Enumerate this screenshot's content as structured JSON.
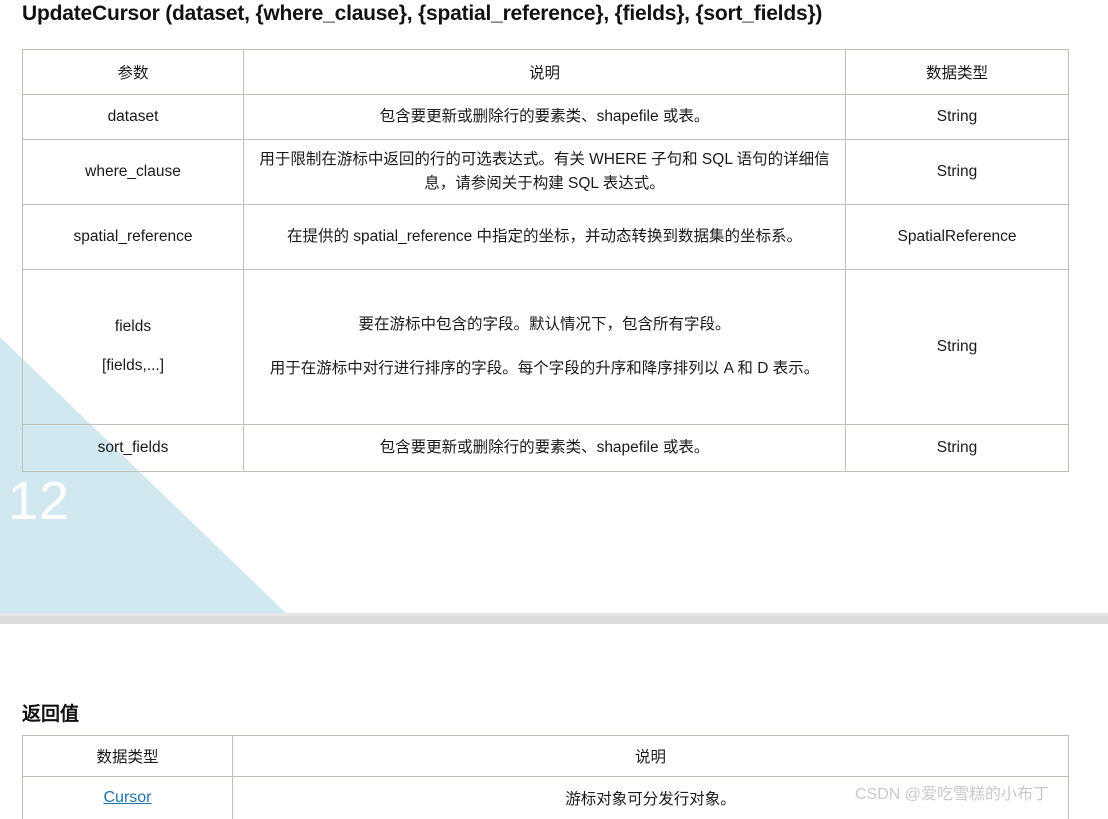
{
  "slide1": {
    "title": "UpdateCursor (dataset, {where_clause}, {spatial_reference}, {fields}, {sort_fields})",
    "page_number": "12",
    "decoration_color": "#d2e8f0",
    "param_table": {
      "headers": [
        "参数",
        "说明",
        "数据类型"
      ],
      "rows": [
        {
          "param": "dataset",
          "param_sub": "",
          "desc": [
            "包含要更新或删除行的要素类、shapefile 或表。"
          ],
          "type": "String"
        },
        {
          "param": "where_clause",
          "param_sub": "",
          "desc": [
            "用于限制在游标中返回的行的可选表达式。有关 WHERE 子句和 SQL 语句的详细信息，请参阅关于构建 SQL 表达式。"
          ],
          "type": "String"
        },
        {
          "param": "spatial_reference",
          "param_sub": "",
          "desc": [
            "在提供的 spatial_reference 中指定的坐标，并动态转换到数据集的坐标系。"
          ],
          "type": "SpatialReference"
        },
        {
          "param": "fields",
          "param_sub": "[fields,...]",
          "desc": [
            "要在游标中包含的字段。默认情况下，包含所有字段。",
            "用于在游标中对行进行排序的字段。每个字段的升序和降序排列以 A 和 D 表示。"
          ],
          "type": "String"
        },
        {
          "param": "sort_fields",
          "param_sub": "",
          "desc": [
            "包含要更新或删除行的要素类、shapefile 或表。"
          ],
          "type": "String"
        }
      ]
    }
  },
  "slide2": {
    "heading": "返回值",
    "return_table": {
      "headers": [
        "数据类型",
        "说明"
      ],
      "rows": [
        {
          "type": "Cursor",
          "type_is_link": true,
          "desc": "游标对象可分发行对象。"
        }
      ]
    },
    "watermark": "CSDN @爱吃雪糕的小布丁"
  }
}
